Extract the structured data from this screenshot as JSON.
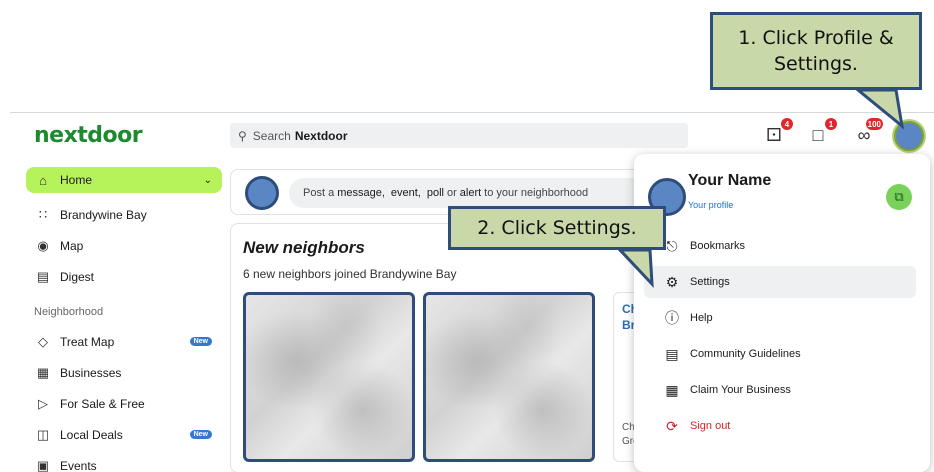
{
  "header": {
    "logo": "nextdoor",
    "search_prefix": "Search",
    "search_brand": "Nextdoor",
    "notifications_badge": "4",
    "messages_badge": "1",
    "requests_badge": "100"
  },
  "sidebar": {
    "items": [
      {
        "label": "Home",
        "icon": "home-icon",
        "active": true
      },
      {
        "label": "Brandywine Bay",
        "icon": "grid-icon"
      },
      {
        "label": "Map",
        "icon": "pin-icon"
      },
      {
        "label": "Digest",
        "icon": "document-icon"
      }
    ],
    "section_label": "Neighborhood",
    "neighborhood_items": [
      {
        "label": "Treat Map",
        "icon": "candy-icon",
        "badge": "New"
      },
      {
        "label": "Businesses",
        "icon": "store-icon"
      },
      {
        "label": "For Sale & Free",
        "icon": "tag-icon"
      },
      {
        "label": "Local Deals",
        "icon": "gift-icon",
        "badge": "New"
      },
      {
        "label": "Events",
        "icon": "calendar-icon"
      }
    ]
  },
  "composer": {
    "pre": "Post a",
    "w1": "message,",
    "w2": "event,",
    "w3": "poll",
    "mid": "or",
    "w4": "alert",
    "post": "to your neighborhood"
  },
  "new_neighbors": {
    "title": "New neighbors",
    "subtitle": "6 new neighbors joined Brandywine Bay",
    "cut_title": "Ch Br",
    "cut_text": "Chr Gre"
  },
  "profile_menu": {
    "name": "Your Name",
    "link": "Your profile",
    "items": [
      {
        "label": "Bookmarks",
        "icon": "bookmark-icon"
      },
      {
        "label": "Settings",
        "icon": "settings-icon",
        "selected": true
      },
      {
        "label": "Help",
        "icon": "help-icon"
      },
      {
        "label": "Community Guidelines",
        "icon": "guidelines-icon"
      },
      {
        "label": "Claim Your Business",
        "icon": "store-icon"
      },
      {
        "label": "Sign out",
        "icon": "signout-icon",
        "color": "#d6232b"
      }
    ]
  },
  "callouts": {
    "step1": "1. Click Profile & Settings.",
    "step2": "2. Click Settings."
  },
  "colors": {
    "brand_green": "#1c8a2e",
    "active_nav": "#b6f25a",
    "callout_fill": "#c8d8a8",
    "callout_border": "#2e4d7a",
    "badge_red": "#e0262b"
  }
}
